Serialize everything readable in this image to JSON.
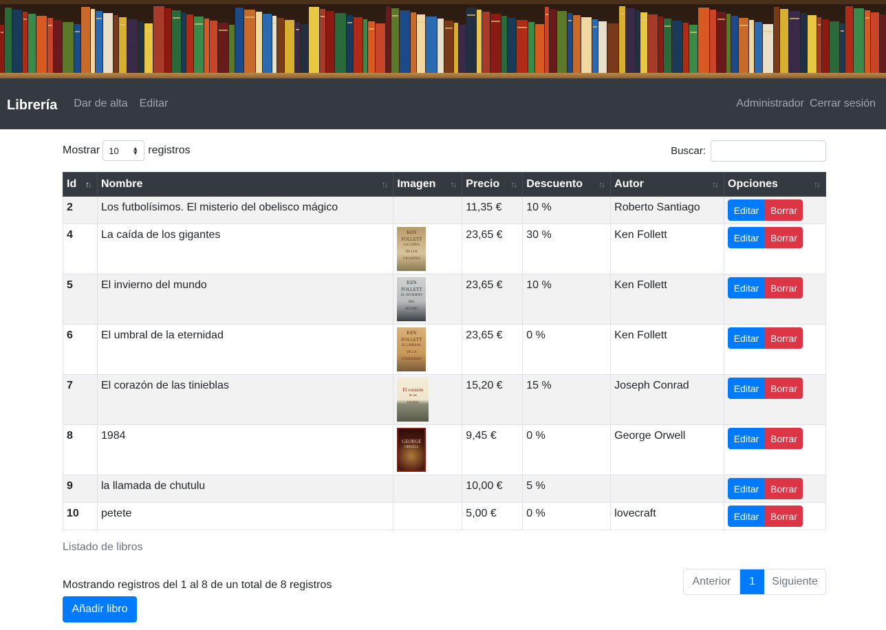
{
  "banner": {
    "alt": "bookshelf-banner"
  },
  "navbar": {
    "brand": "Librería",
    "links": [
      "Dar de alta",
      "Editar"
    ],
    "right_links": [
      "Administrador",
      "Cerrar sesión"
    ]
  },
  "length": {
    "prefix": "Mostrar",
    "value": "10",
    "suffix": "registros"
  },
  "search": {
    "label": "Buscar:",
    "value": ""
  },
  "table": {
    "headers": [
      "Id",
      "Nombre",
      "Imagen",
      "Precio",
      "Descuento",
      "Autor",
      "Opciones"
    ],
    "rows": [
      {
        "id": "2",
        "nombre": "Los futbolísimos. El misterio del obelisco mágico",
        "imagen": "",
        "precio": "11,35 €",
        "descuento": "10 %",
        "autor": "Roberto Santiago"
      },
      {
        "id": "4",
        "nombre": "La caída de los gigantes",
        "imagen": "cover-gigantes",
        "precio": "23,65 €",
        "descuento": "30 %",
        "autor": "Ken Follett"
      },
      {
        "id": "5",
        "nombre": "El invierno del mundo",
        "imagen": "cover-invierno",
        "precio": "23,65 €",
        "descuento": "10 %",
        "autor": "Ken Follett"
      },
      {
        "id": "6",
        "nombre": "El umbral de la eternidad",
        "imagen": "cover-umbral",
        "precio": "23,65 €",
        "descuento": "0 %",
        "autor": "Ken Follett"
      },
      {
        "id": "7",
        "nombre": "El corazón de las tinieblas",
        "imagen": "cover-corazon",
        "precio": "15,20 €",
        "descuento": "15 %",
        "autor": "Joseph Conrad"
      },
      {
        "id": "8",
        "nombre": "1984",
        "imagen": "cover-1984",
        "precio": "9,45 €",
        "descuento": "0 %",
        "autor": "George Orwell"
      },
      {
        "id": "9",
        "nombre": "la llamada de chutulu",
        "imagen": "",
        "precio": "10,00 €",
        "descuento": "5 %",
        "autor": ""
      },
      {
        "id": "10",
        "nombre": "petete",
        "imagen": "",
        "precio": "5,00 €",
        "descuento": "0 %",
        "autor": "lovecraft"
      }
    ],
    "edit_label": "Editar",
    "delete_label": "Borrar"
  },
  "caption": "Listado de libros",
  "info": "Mostrando registros del 1 al 8 de un total de 8 registros",
  "pager": {
    "prev": "Anterior",
    "current": "1",
    "next": "Siguiente"
  },
  "add_button": "Añadir libro",
  "colors": {
    "navbar": "#343a40",
    "primary": "#007bff",
    "danger": "#dc3545"
  }
}
